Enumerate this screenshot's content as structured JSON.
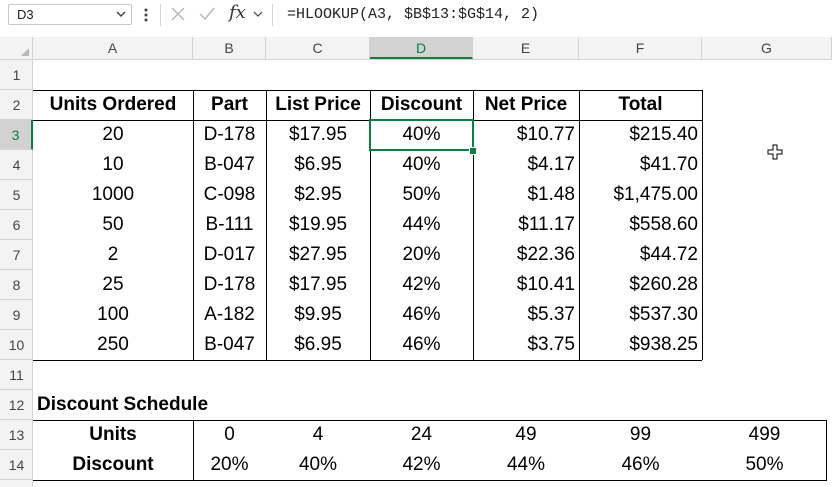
{
  "formula_bar": {
    "name_box": "D3",
    "formula": "=HLOOKUP(A3, $B$13:$G$14, 2)",
    "fx_label": "fx"
  },
  "columns": [
    "A",
    "B",
    "C",
    "D",
    "E",
    "F",
    "G"
  ],
  "rows": [
    "1",
    "2",
    "3",
    "4",
    "5",
    "6",
    "7",
    "8",
    "9",
    "10",
    "11",
    "12",
    "13",
    "14"
  ],
  "headers": [
    "Units Ordered",
    "Part",
    "List Price",
    "Discount",
    "Net Price",
    "Total"
  ],
  "orders": [
    [
      "20",
      "D-178",
      "$17.95",
      "40%",
      "$10.77",
      "$215.40"
    ],
    [
      "10",
      "B-047",
      "$6.95",
      "40%",
      "$4.17",
      "$41.70"
    ],
    [
      "1000",
      "C-098",
      "$2.95",
      "50%",
      "$1.48",
      "$1,475.00"
    ],
    [
      "50",
      "B-111",
      "$19.95",
      "44%",
      "$11.17",
      "$558.60"
    ],
    [
      "2",
      "D-017",
      "$27.95",
      "20%",
      "$22.36",
      "$44.72"
    ],
    [
      "25",
      "D-178",
      "$17.95",
      "42%",
      "$10.41",
      "$260.28"
    ],
    [
      "100",
      "A-182",
      "$9.95",
      "46%",
      "$5.37",
      "$537.30"
    ],
    [
      "250",
      "B-047",
      "$6.95",
      "46%",
      "$3.75",
      "$938.25"
    ]
  ],
  "schedule": {
    "title": "Discount Schedule",
    "units_label": "Units",
    "discount_label": "Discount",
    "units": [
      "0",
      "4",
      "24",
      "49",
      "99",
      "499"
    ],
    "discounts": [
      "20%",
      "40%",
      "42%",
      "44%",
      "46%",
      "50%"
    ]
  },
  "selection": {
    "active_cell": "D3",
    "accent": "#107c41"
  }
}
